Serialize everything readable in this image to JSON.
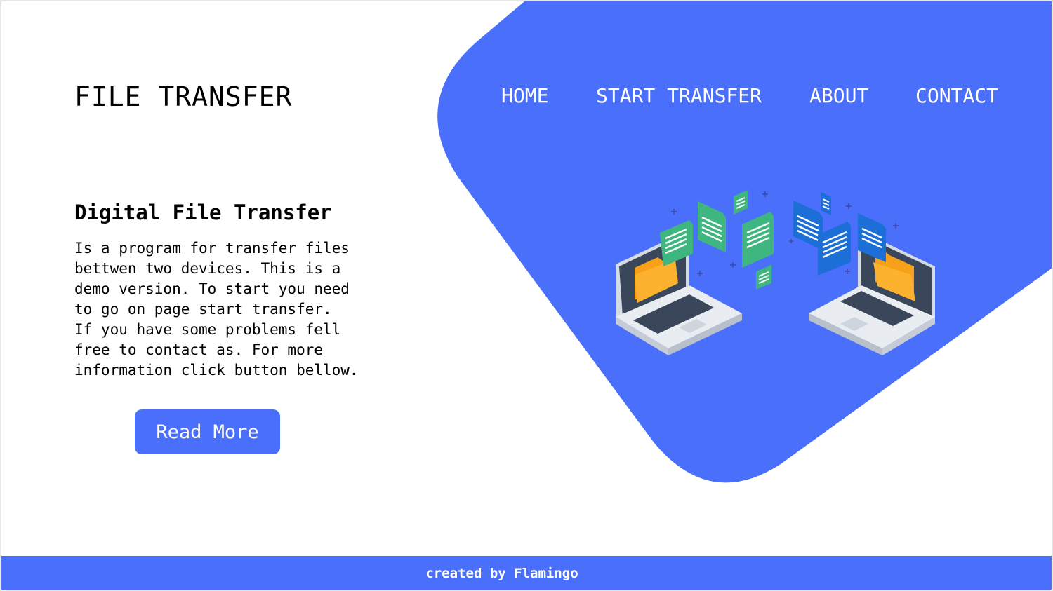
{
  "brand": {
    "title": "FILE TRANSFER"
  },
  "nav": {
    "items": [
      {
        "label": "HOME"
      },
      {
        "label": "START TRANSFER"
      },
      {
        "label": "ABOUT"
      },
      {
        "label": "CONTACT"
      }
    ]
  },
  "hero": {
    "heading": "Digital File Transfer",
    "body": "Is a program for transfer files\nbettwen two devices. This is a\ndemo version. To start you need\nto go on page start transfer.\nIf you have some problems fell\nfree to contact as. For more\ninformation click button bellow.",
    "button_label": "Read More"
  },
  "illustration": {
    "icons": [
      "laptop-icon",
      "folder-icon",
      "document-icon"
    ]
  },
  "footer": {
    "credit": "created by Flamingo"
  },
  "colors": {
    "accent": "#4a6ffb",
    "text": "#000000",
    "nav_text": "#ffffff",
    "doc_green": "#3fb67f",
    "doc_blue": "#1b6fd6",
    "folder_orange": "#f7a11a",
    "laptop_body": "#e9edf2",
    "screen_dark": "#3a4659"
  }
}
